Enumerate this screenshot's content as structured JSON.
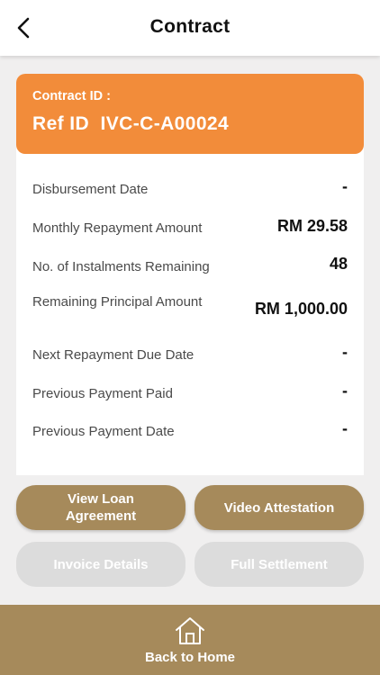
{
  "header": {
    "title": "Contract",
    "back_icon": "chevron-left-icon"
  },
  "contract": {
    "id_label": "Contract ID :",
    "id_value": "Ref ID  IVC-C-A00024"
  },
  "details": [
    {
      "label": "Disbursement Date",
      "value": "-"
    },
    {
      "label": "Monthly Repayment Amount",
      "value": "RM 29.58"
    },
    {
      "label": "No. of Instalments Remaining",
      "value": "48"
    },
    {
      "label": "Remaining Principal Amount",
      "value": "RM 1,000.00"
    },
    {
      "label": "Next Repayment Due Date",
      "value": "-"
    },
    {
      "label": "Previous Payment Paid",
      "value": "-"
    },
    {
      "label": "Previous Payment Date",
      "value": "-"
    }
  ],
  "actions": {
    "view_loan_agreement": "View Loan Agreement",
    "video_attestation": "Video Attestation",
    "invoice_details": "Invoice Details",
    "full_settlement": "Full Settlement"
  },
  "footer": {
    "label": "Back to Home",
    "icon": "home-icon"
  },
  "colors": {
    "accent_orange": "#f28c3a",
    "brand_brown": "#a68a5b",
    "disabled_gray": "#dcdcdc",
    "background": "#f0efef"
  }
}
